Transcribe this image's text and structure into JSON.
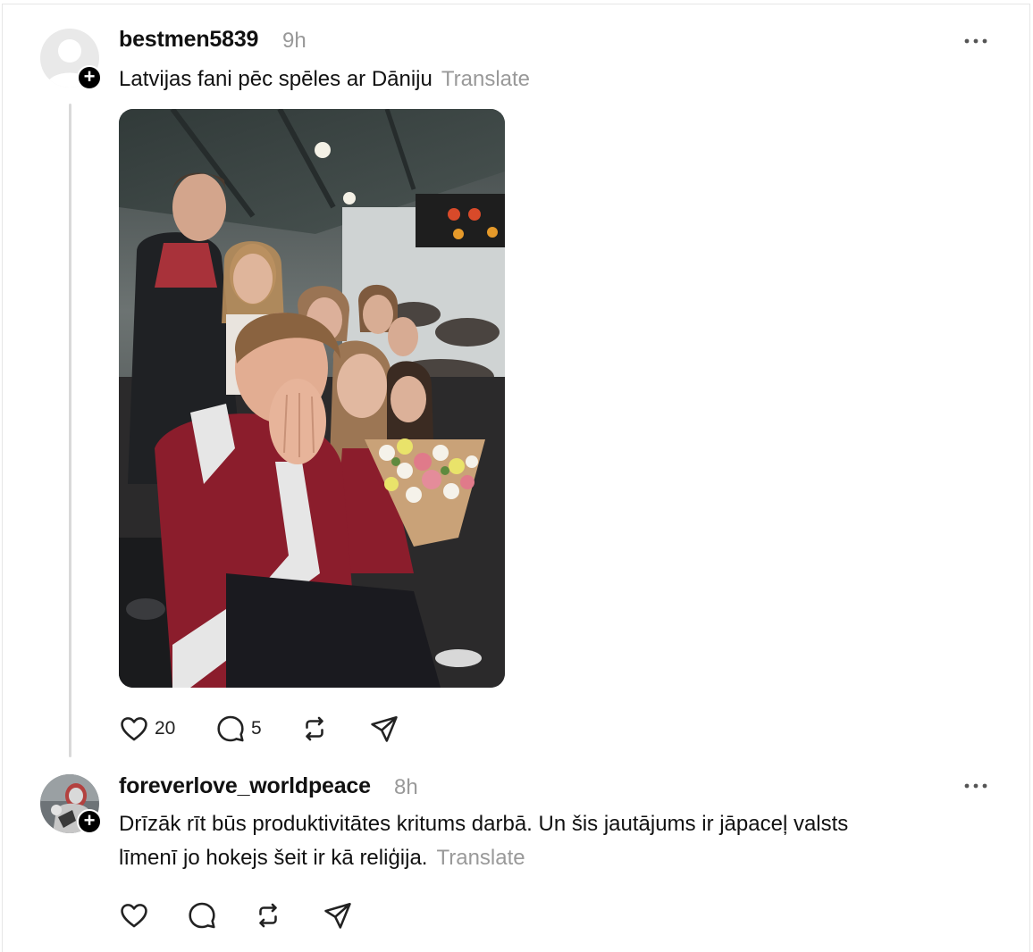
{
  "posts": [
    {
      "username": "bestmen5839",
      "time": "9h",
      "text": "Latvijas fani pēc spēles ar Dāniju",
      "translate_label": "Translate",
      "likes": "20",
      "replies": "5",
      "avatar": "default-user-icon",
      "has_image": true
    },
    {
      "username": "foreverlove_worldpeace",
      "time": "8h",
      "text_line1": "Drīzāk rīt būs produktivitātes kritums darbā. Un šis jautājums ir jāpaceļ valsts",
      "text_line2": "līmenī jo hokejs šeit ir kā reliģija.",
      "translate_label": "Translate",
      "avatar": "armored-figure-avatar"
    }
  ],
  "icons": {
    "follow": "plus-icon",
    "more": "more-horizontal-icon",
    "like": "heart-icon",
    "reply": "comment-icon",
    "repost": "repost-icon",
    "share": "send-icon"
  },
  "colors": {
    "muted_text": "#999999",
    "thread_line": "#d9d9d9",
    "jersey_red": "#8b1d2c"
  }
}
